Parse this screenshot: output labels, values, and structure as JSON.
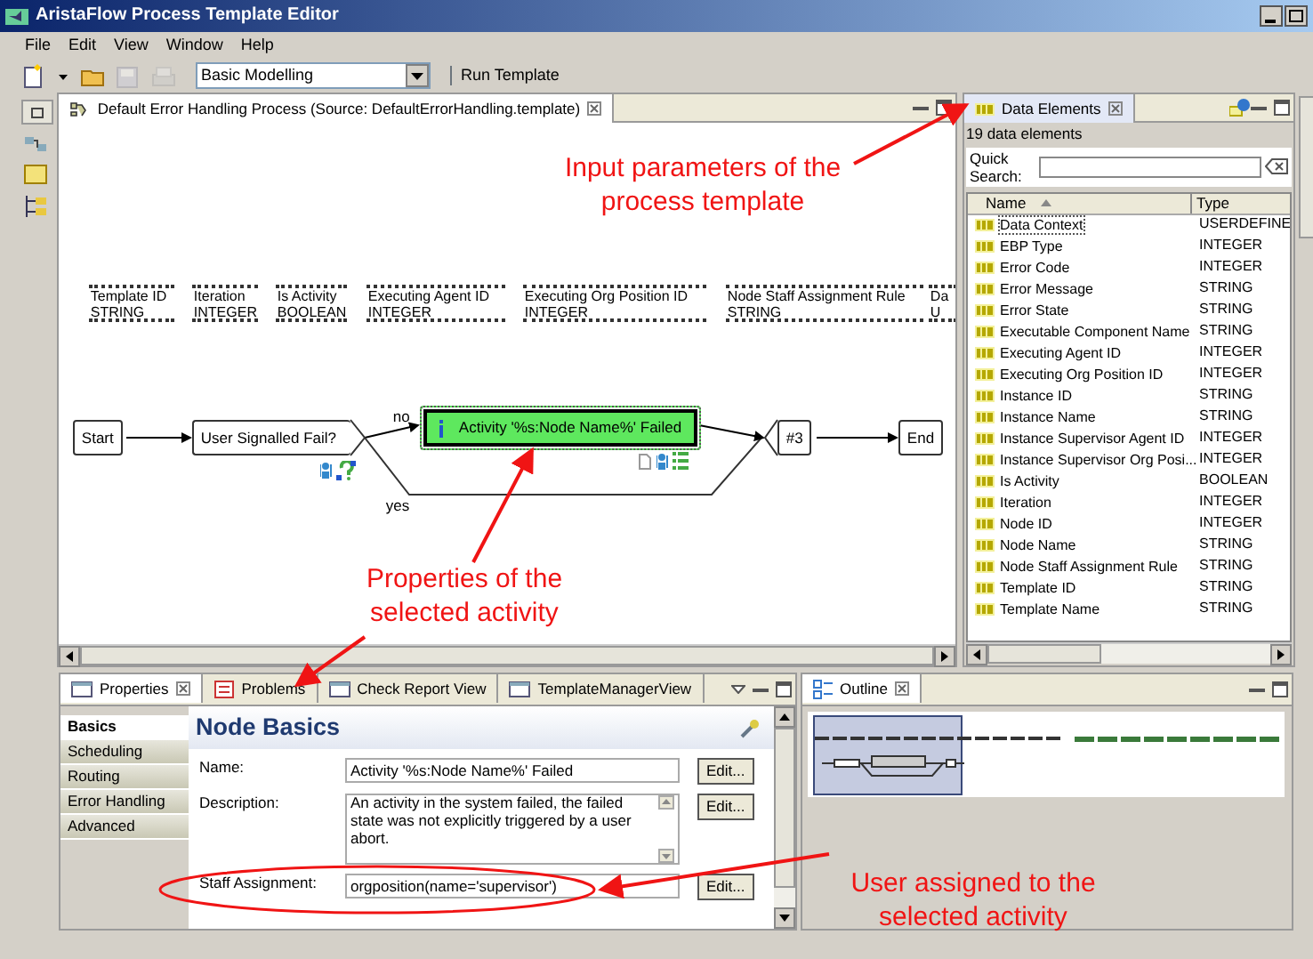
{
  "window": {
    "title": "AristaFlow Process Template Editor"
  },
  "menu": [
    "File",
    "Edit",
    "View",
    "Window",
    "Help"
  ],
  "toolbar": {
    "items": [
      {
        "kind": "new",
        "disabled": false
      },
      {
        "kind": "dropdown",
        "disabled": false
      },
      {
        "kind": "open",
        "disabled": false
      },
      {
        "kind": "save",
        "disabled": true
      },
      {
        "kind": "print",
        "disabled": true
      }
    ],
    "perspective": "Basic Modelling",
    "run": "Run Template"
  },
  "editor": {
    "tab": "Default Error Handling Process (Source: DefaultErrorHandling.template)",
    "data_elements": [
      {
        "name": "Template ID",
        "type": "STRING"
      },
      {
        "name": "Iteration",
        "type": "INTEGER"
      },
      {
        "name": "Is Activity",
        "type": "BOOLEAN"
      },
      {
        "name": "Executing Agent ID",
        "type": "INTEGER"
      },
      {
        "name": "Executing Org Position ID",
        "type": "INTEGER"
      },
      {
        "name": "Node Staff Assignment Rule",
        "type": "STRING"
      },
      {
        "name": "Da",
        "type": "U"
      }
    ],
    "nodes": [
      {
        "kind": "start",
        "label": "Start",
        "selected": false
      },
      {
        "kind": "decision",
        "label": "User Signalled Fail?",
        "selected": false
      },
      {
        "kind": "activity",
        "label": "Activity '%s:Node Name%' Failed",
        "selected": true
      },
      {
        "kind": "join",
        "label": "#3",
        "selected": false
      },
      {
        "kind": "end",
        "label": "End",
        "selected": false
      }
    ],
    "edge_labels": [
      "no",
      "yes"
    ]
  },
  "data_panel": {
    "tab": "Data Elements",
    "count": "19 data elements",
    "search_label": "Quick Search:",
    "columns": [
      "Name",
      "Type"
    ],
    "rows": [
      {
        "name": "Data Context",
        "type": "USERDEFINE",
        "selected": true
      },
      {
        "name": "EBP Type",
        "type": "INTEGER",
        "selected": false
      },
      {
        "name": "Error Code",
        "type": "INTEGER",
        "selected": false
      },
      {
        "name": "Error Message",
        "type": "STRING",
        "selected": false
      },
      {
        "name": "Error State",
        "type": "STRING",
        "selected": false
      },
      {
        "name": "Executable Component Name",
        "type": "STRING",
        "selected": false
      },
      {
        "name": "Executing Agent ID",
        "type": "INTEGER",
        "selected": false
      },
      {
        "name": "Executing Org Position ID",
        "type": "INTEGER",
        "selected": false
      },
      {
        "name": "Instance ID",
        "type": "STRING",
        "selected": false
      },
      {
        "name": "Instance Name",
        "type": "STRING",
        "selected": false
      },
      {
        "name": "Instance Supervisor Agent ID",
        "type": "INTEGER",
        "selected": false
      },
      {
        "name": "Instance Supervisor Org Posi...",
        "type": "INTEGER",
        "selected": false
      },
      {
        "name": "Is Activity",
        "type": "BOOLEAN",
        "selected": false
      },
      {
        "name": "Iteration",
        "type": "INTEGER",
        "selected": false
      },
      {
        "name": "Node ID",
        "type": "INTEGER",
        "selected": false
      },
      {
        "name": "Node Name",
        "type": "STRING",
        "selected": false
      },
      {
        "name": "Node Staff Assignment Rule",
        "type": "STRING",
        "selected": false
      },
      {
        "name": "Template ID",
        "type": "STRING",
        "selected": false
      },
      {
        "name": "Template Name",
        "type": "STRING",
        "selected": false
      }
    ]
  },
  "properties": {
    "tabs": [
      {
        "label": "Properties",
        "selected": true
      },
      {
        "label": "Problems",
        "selected": false
      },
      {
        "label": "Check Report View",
        "selected": false
      },
      {
        "label": "TemplateManagerView",
        "selected": false
      }
    ],
    "sections": [
      {
        "label": "Basics",
        "selected": true
      },
      {
        "label": "Scheduling",
        "selected": false
      },
      {
        "label": "Routing",
        "selected": false
      },
      {
        "label": "Error Handling",
        "selected": false
      },
      {
        "label": "Advanced",
        "selected": false
      }
    ],
    "heading": "Node Basics",
    "fields": [
      {
        "kind": "line",
        "label": "Name:",
        "value": "Activity '%s:Node Name%' Failed",
        "button": "Edit..."
      },
      {
        "kind": "multiline",
        "label": "Description:",
        "value": "An activity in the system failed, the failed state was not explicitly triggered by a user abort.",
        "button": "Edit..."
      },
      {
        "kind": "line",
        "label": "Staff Assignment:",
        "value": "orgposition(name='supervisor')",
        "button": "Edit..."
      }
    ]
  },
  "outline": {
    "tab": "Outline"
  },
  "annotations": [
    {
      "text": "Input parameters of the process template"
    },
    {
      "text": "Properties of the selected activity"
    },
    {
      "text": "User assigned to the selected activity"
    }
  ]
}
